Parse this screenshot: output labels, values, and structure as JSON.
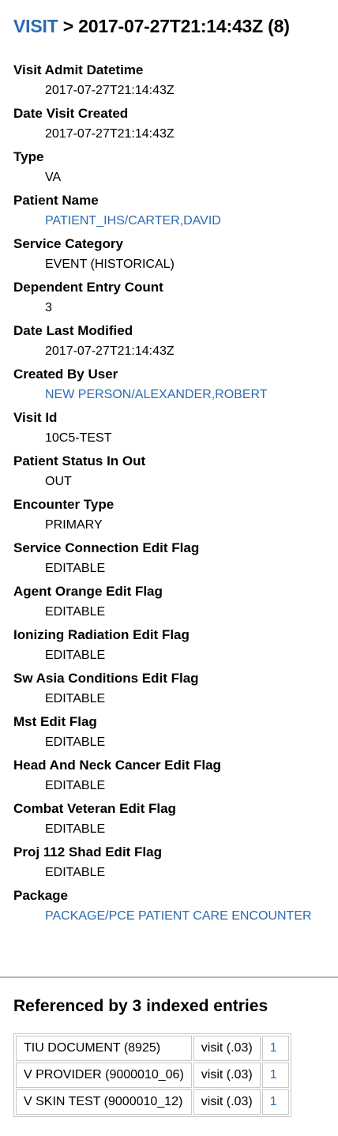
{
  "header": {
    "link": "VISIT",
    "separator": ">",
    "title": "2017-07-27T21:14:43Z (8)"
  },
  "fields": [
    {
      "label": "Visit Admit Datetime",
      "value": "2017-07-27T21:14:43Z",
      "link": false
    },
    {
      "label": "Date Visit Created",
      "value": "2017-07-27T21:14:43Z",
      "link": false
    },
    {
      "label": "Type",
      "value": "VA",
      "link": false
    },
    {
      "label": "Patient Name",
      "value": "PATIENT_IHS/CARTER,DAVID",
      "link": true
    },
    {
      "label": "Service Category",
      "value": "EVENT (HISTORICAL)",
      "link": false
    },
    {
      "label": "Dependent Entry Count",
      "value": "3",
      "link": false
    },
    {
      "label": "Date Last Modified",
      "value": "2017-07-27T21:14:43Z",
      "link": false
    },
    {
      "label": "Created By User",
      "value": "NEW PERSON/ALEXANDER,ROBERT",
      "link": true
    },
    {
      "label": "Visit Id",
      "value": "10C5-TEST",
      "link": false
    },
    {
      "label": "Patient Status In Out",
      "value": "OUT",
      "link": false
    },
    {
      "label": "Encounter Type",
      "value": "PRIMARY",
      "link": false
    },
    {
      "label": "Service Connection Edit Flag",
      "value": "EDITABLE",
      "link": false
    },
    {
      "label": "Agent Orange Edit Flag",
      "value": "EDITABLE",
      "link": false
    },
    {
      "label": "Ionizing Radiation Edit Flag",
      "value": "EDITABLE",
      "link": false
    },
    {
      "label": "Sw Asia Conditions Edit Flag",
      "value": "EDITABLE",
      "link": false
    },
    {
      "label": "Mst Edit Flag",
      "value": "EDITABLE",
      "link": false
    },
    {
      "label": "Head And Neck Cancer Edit Flag",
      "value": "EDITABLE",
      "link": false
    },
    {
      "label": "Combat Veteran Edit Flag",
      "value": "EDITABLE",
      "link": false
    },
    {
      "label": "Proj 112 Shad Edit Flag",
      "value": "EDITABLE",
      "link": false
    },
    {
      "label": "Package",
      "value": "PACKAGE/PCE PATIENT CARE ENCOUNTER",
      "link": true
    }
  ],
  "references": {
    "title": "Referenced by 3 indexed entries",
    "rows": [
      {
        "file": "TIU DOCUMENT (8925)",
        "field": "visit (.03)",
        "count": "1"
      },
      {
        "file": "V PROVIDER (9000010_06)",
        "field": "visit (.03)",
        "count": "1"
      },
      {
        "file": "V SKIN TEST (9000010_12)",
        "field": "visit (.03)",
        "count": "1"
      }
    ]
  },
  "colors": {
    "link": "#2a6ab0",
    "divider": "#b9b9b9",
    "table_border": "#c8c8c8"
  }
}
